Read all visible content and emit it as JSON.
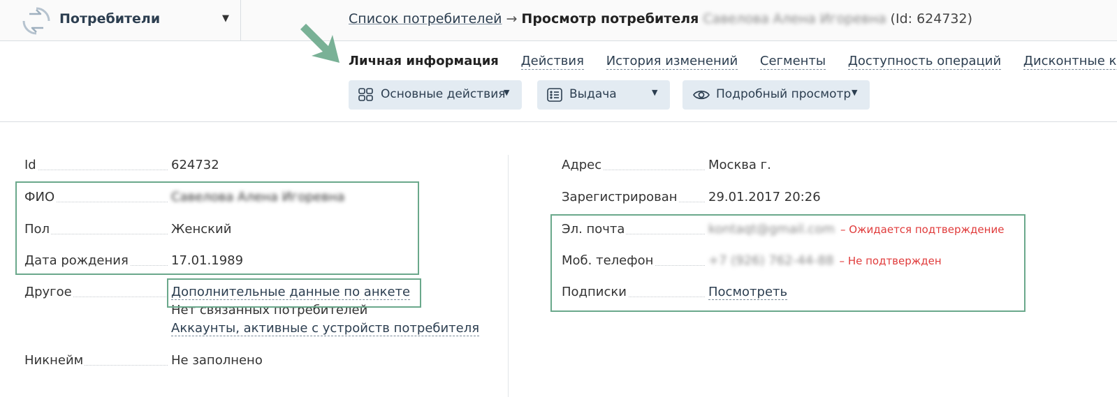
{
  "colors": {
    "accent": "#6aa88b",
    "link": "#2c3e50",
    "warning": "#e03b3b",
    "button_bg": "#e3ebf2"
  },
  "app_switch": {
    "name": "Потребители",
    "logo_icon": "sync-arrows-icon",
    "caret": "▼"
  },
  "breadcrumb": {
    "link": "Список потребителей",
    "separator": "→",
    "current": "Просмотр потребителя",
    "name_blurred": "Савелова Алена Игоревна",
    "id_text": "(Id: 624732)"
  },
  "tabs": [
    {
      "label": "Личная информация",
      "active": true
    },
    {
      "label": "Действия",
      "active": false
    },
    {
      "label": "История изменений",
      "active": false
    },
    {
      "label": "Сегменты",
      "active": false
    },
    {
      "label": "Доступность операций",
      "active": false
    },
    {
      "label": "Дисконтные карты",
      "active": false
    }
  ],
  "actions": [
    {
      "label": "Основные действия",
      "icon": "grid-icon"
    },
    {
      "label": "Выдача",
      "icon": "list-icon"
    },
    {
      "label": "Подробный просмотр",
      "icon": "eye-icon"
    }
  ],
  "left_fields": {
    "id": {
      "label": "Id",
      "value": "624732"
    },
    "fio": {
      "label": "ФИО",
      "value": "Савелова Алена Игоревна"
    },
    "gender": {
      "label": "Пол",
      "value": "Женский"
    },
    "birth": {
      "label": "Дата рождения",
      "value": "17.01.1989"
    },
    "other": {
      "label": "Другое",
      "link": "Дополнительные данные по анкете",
      "text": "Нет связанных потребителей",
      "link2": "Аккаунты, активные с устройств потребителя"
    },
    "nickname": {
      "label": "Никнейм",
      "value": "Не заполнено"
    }
  },
  "right_fields": {
    "address": {
      "label": "Адрес",
      "value": "Москва г."
    },
    "registered": {
      "label": "Зарегистрирован",
      "value": "29.01.2017 20:26"
    },
    "email": {
      "label": "Эл. почта",
      "value": "kontaqt@gmail.com",
      "status": "– Ожидается подтверждение"
    },
    "phone": {
      "label": "Моб. телефон",
      "value": "+7 (926) 762-44-88",
      "status": "– Не подтвержден"
    },
    "subscriptions": {
      "label": "Подписки",
      "link": "Посмотреть"
    }
  }
}
